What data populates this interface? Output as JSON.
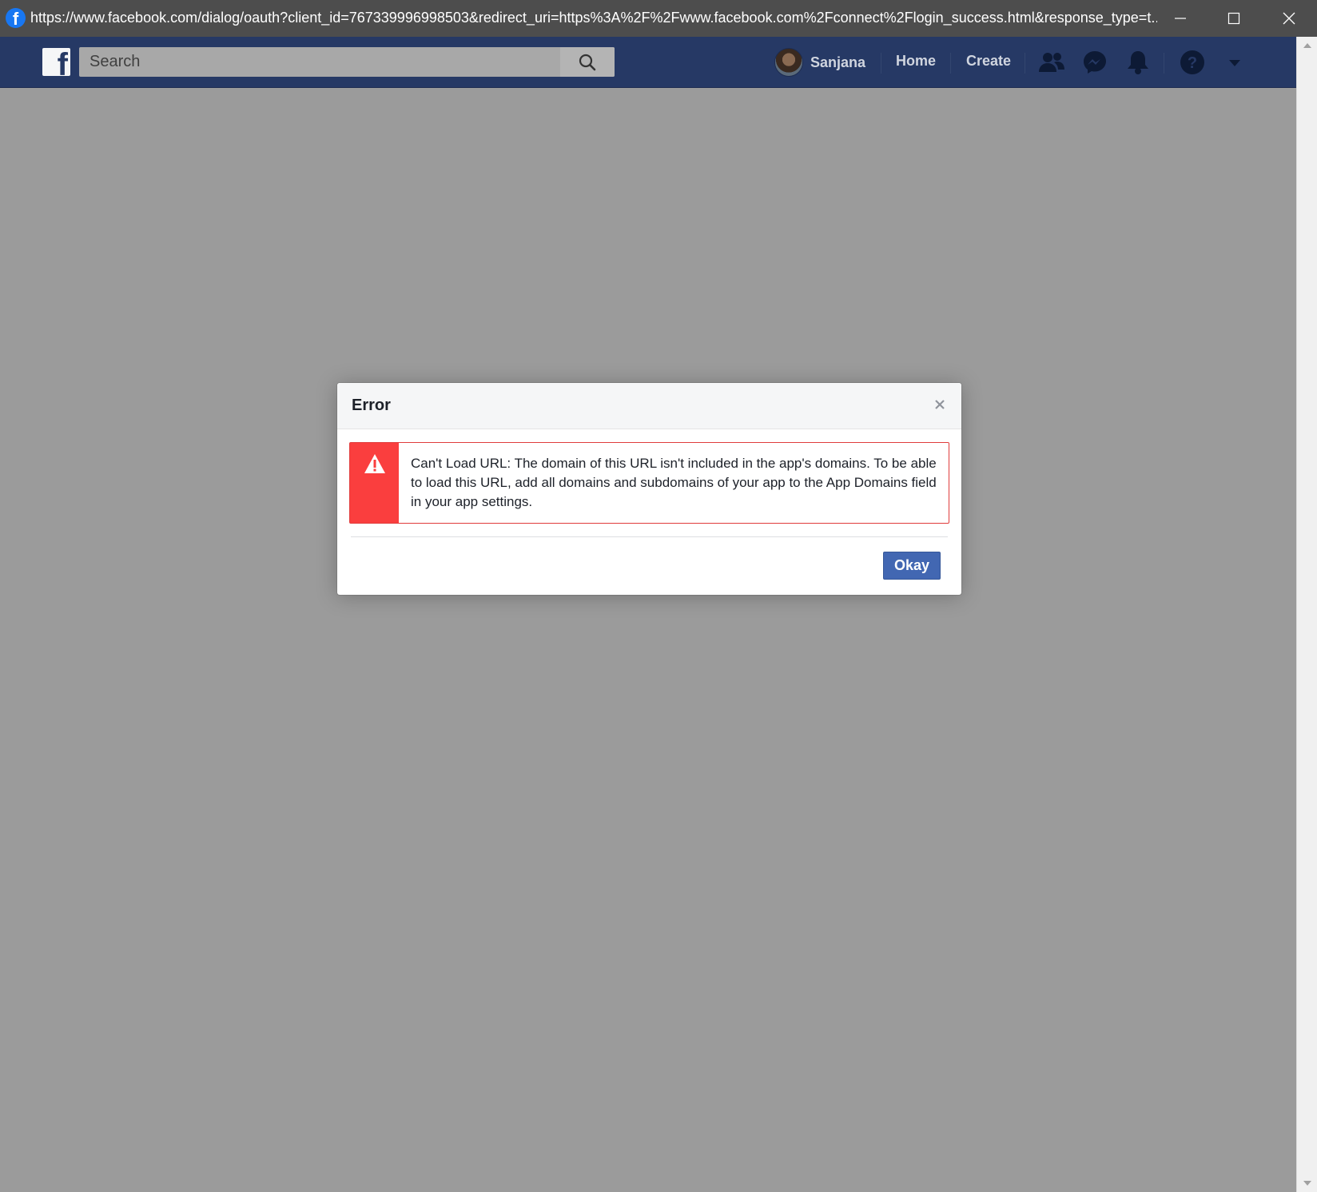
{
  "window": {
    "url": "https://www.facebook.com/dialog/oauth?client_id=767339996998503&redirect_uri=https%3A%2F%2Fwww.facebook.com%2Fconnect%2Flogin_success.html&response_type=t...",
    "favicon_letter": "f",
    "controls": [
      "minimize",
      "maximize",
      "close"
    ]
  },
  "navbar": {
    "logo_letter": "f",
    "search": {
      "placeholder": "Search",
      "value": ""
    },
    "profile_name": "Sanjana",
    "links": {
      "home": "Home",
      "create": "Create"
    },
    "icons": [
      "friends-icon",
      "messenger-icon",
      "notifications-icon",
      "help-icon",
      "menu-dropdown-icon"
    ]
  },
  "dialog": {
    "title": "Error",
    "message": "Can't Load URL: The domain of this URL isn't included in the app's domains. To be able to load this URL, add all domains and subdomains of your app to the App Domains field in your app settings.",
    "ok_label": "Okay"
  },
  "colors": {
    "navbar_bg": "#263965",
    "overlay_bg": "#9b9b9b",
    "error_red": "#fa3e3e",
    "button_blue": "#4267b2"
  }
}
